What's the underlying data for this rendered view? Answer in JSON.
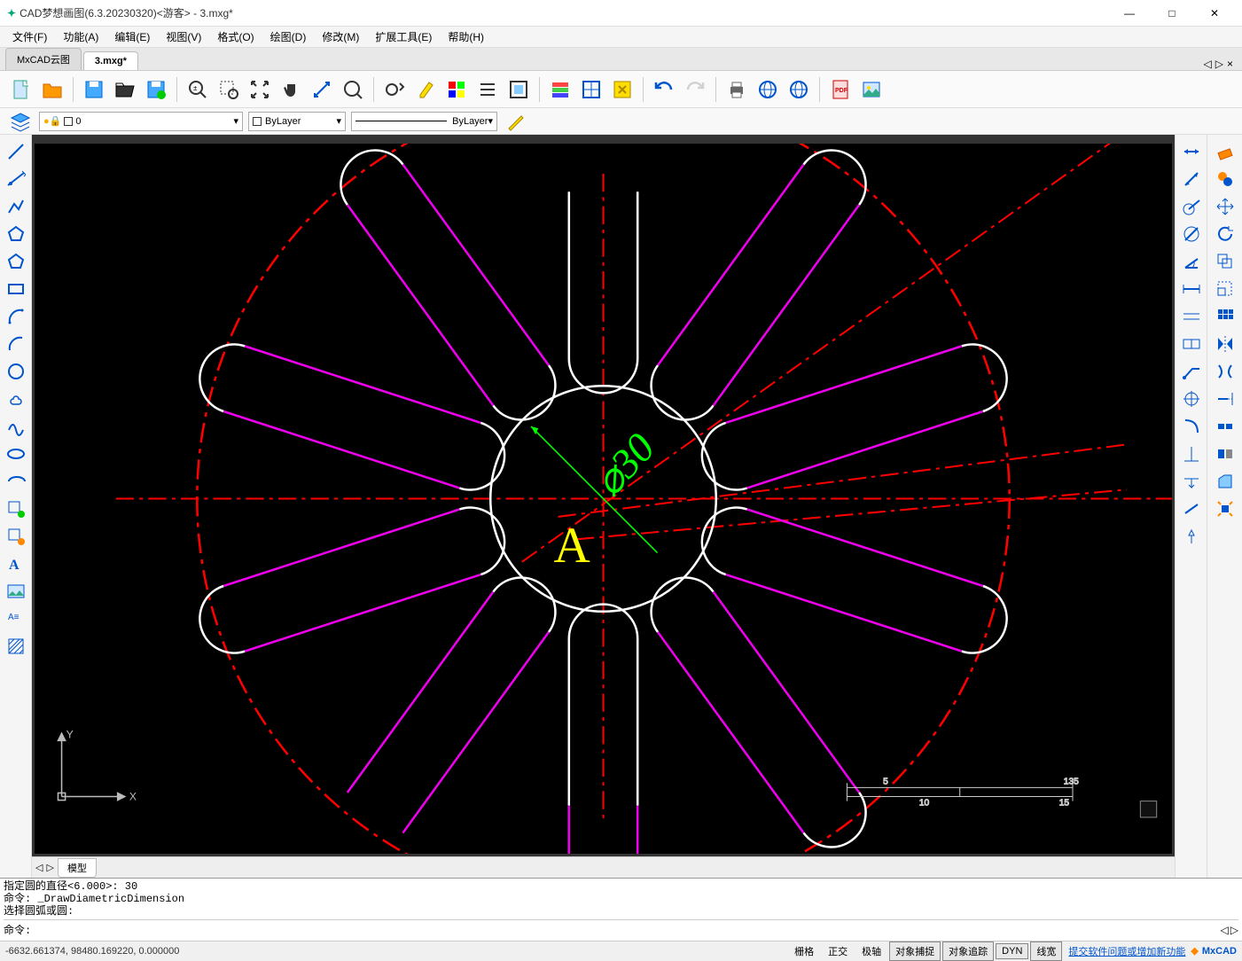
{
  "window": {
    "title": "CAD梦想画图(6.3.20230320)<游客> - 3.mxg*"
  },
  "menu": {
    "file": "文件(F)",
    "func": "功能(A)",
    "edit": "编辑(E)",
    "view": "视图(V)",
    "format": "格式(O)",
    "draw": "绘图(D)",
    "modify": "修改(M)",
    "ext": "扩展工具(E)",
    "help": "帮助(H)"
  },
  "tabs": {
    "cloud": "MxCAD云图",
    "doc": "3.mxg*"
  },
  "props": {
    "layer": "0",
    "color": "ByLayer",
    "linetype": "ByLayer"
  },
  "canvas": {
    "dim_label": "⌀30",
    "text_A": "A",
    "y_axis": "Y",
    "x_axis": "X",
    "ruler": {
      "a": "5",
      "b": "135",
      "c": "10",
      "d": "15"
    }
  },
  "model_tab": "模型",
  "cmd": {
    "l1": "指定圆的直径<6.000>:  30",
    "l2": "命令: _DrawDiametricDimension",
    "l3": " 选择圆弧或圆:",
    "prompt": "命令: "
  },
  "status": {
    "coords": "-6632.661374,  98480.169220,  0.000000",
    "grid": "栅格",
    "ortho": "正交",
    "polar": "极轴",
    "osnap": "对象捕捉",
    "otrack": "对象追踪",
    "dyn": "DYN",
    "lw": "线宽",
    "feedback": "提交软件问题或增加新功能",
    "brand": "MxCAD"
  }
}
